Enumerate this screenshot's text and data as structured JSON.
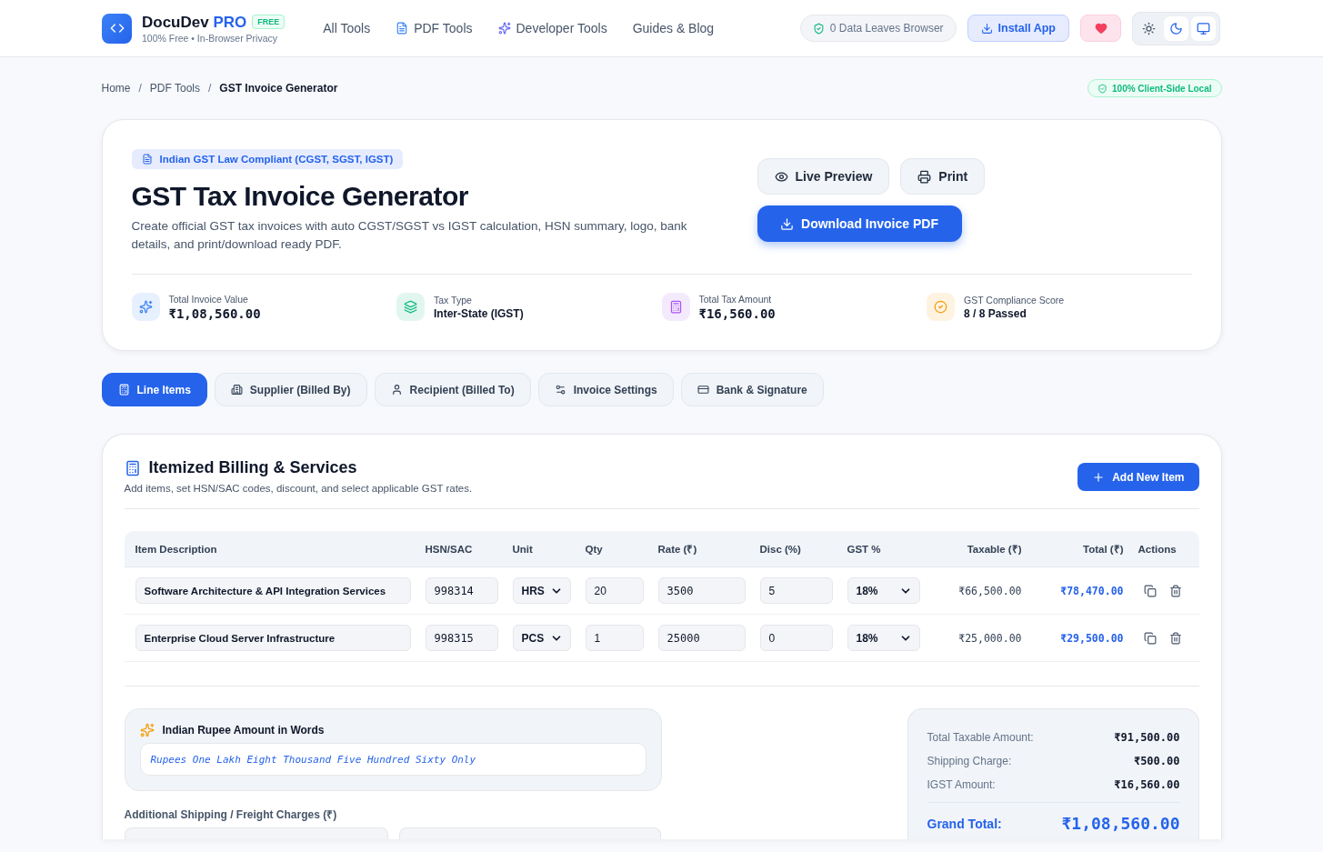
{
  "brand": {
    "name": "DocuDev",
    "accent": "PRO",
    "badge": "FREE",
    "tagline": "100% Free • In-Browser Privacy"
  },
  "nav": [
    "All Tools",
    "PDF Tools",
    "Developer Tools",
    "Guides & Blog"
  ],
  "privacy_badge": "0 Data Leaves Browser",
  "install_button": "Install App",
  "theme_options": [
    {
      "selected": false
    },
    {
      "selected": true
    },
    {
      "selected": true
    }
  ],
  "breadcrumb": {
    "items": [
      "Home",
      "PDF Tools",
      "GST Invoice Generator"
    ],
    "separator": "/"
  },
  "local_badge": "100% Client-Side Local",
  "hero": {
    "compliance_badge": "Indian GST Law Compliant (CGST, SGST, IGST)",
    "title": "GST Tax Invoice Generator",
    "description": "Create official GST tax invoices with auto CGST/SGST vs IGST calculation, HSN summary, logo, bank details, and print/download ready PDF.",
    "buttons": [
      {
        "label": "Live Preview",
        "kind": "secondary"
      },
      {
        "label": "Print",
        "kind": "secondary"
      },
      {
        "label": "Download Invoice PDF",
        "kind": "primary"
      }
    ],
    "stats": [
      {
        "label": "Total Invoice Value",
        "value": "₹1,08,560.00",
        "kind": "amount",
        "color": "#3b82f6"
      },
      {
        "label": "Tax Type",
        "value": "Inter-State (IGST)",
        "kind": "text",
        "color": "#10b981"
      },
      {
        "label": "Total Tax Amount",
        "value": "₹16,560.00",
        "kind": "amount",
        "color": "#a855f7"
      },
      {
        "label": "GST Compliance Score",
        "value": "8 / 8 Passed",
        "kind": "text",
        "color": "#f59e0b"
      }
    ]
  },
  "tabs": [
    {
      "label": "Line Items",
      "selected": true
    },
    {
      "label": "Supplier (Billed By)",
      "selected": false
    },
    {
      "label": "Recipient (Billed To)",
      "selected": false
    },
    {
      "label": "Invoice Settings",
      "selected": false
    },
    {
      "label": "Bank & Signature",
      "selected": false
    }
  ],
  "billing": {
    "title": "Itemized Billing & Services",
    "subtitle": "Add items, set HSN/SAC codes, discount, and select applicable GST rates.",
    "add_button": "Add New Item",
    "columns": [
      "Item Description",
      "HSN/SAC",
      "Unit",
      "Qty",
      "Rate (₹)",
      "Disc (%)",
      "GST %",
      "Taxable (₹)",
      "Total (₹)",
      "Actions"
    ],
    "rows": [
      {
        "description": "Software Architecture & API Integration Services",
        "hsn": "998314",
        "unit": "HRS",
        "qty": "20",
        "rate": "3500",
        "discount": "5",
        "gst": "18%",
        "taxable": "₹66,500.00",
        "total": "₹78,470.00"
      },
      {
        "description": "Enterprise Cloud Server Infrastructure",
        "hsn": "998315",
        "unit": "PCS",
        "qty": "1",
        "rate": "25000",
        "discount": "0",
        "gst": "18%",
        "taxable": "₹25,000.00",
        "total": "₹29,500.00"
      }
    ]
  },
  "amount_in_words": {
    "title": "Indian Rupee Amount in Words",
    "value": "Rupees One Lakh Eight Thousand Five Hundred Sixty Only"
  },
  "shipping": {
    "label": "Additional Shipping / Freight Charges (₹)"
  },
  "summary": {
    "lines": [
      {
        "label": "Total Taxable Amount:",
        "value": "₹91,500.00"
      },
      {
        "label": "Shipping Charge:",
        "value": "₹500.00"
      },
      {
        "label": "IGST Amount:",
        "value": "₹16,560.00"
      }
    ],
    "grand_label": "Grand Total:",
    "grand_value": "₹1,08,560.00"
  }
}
